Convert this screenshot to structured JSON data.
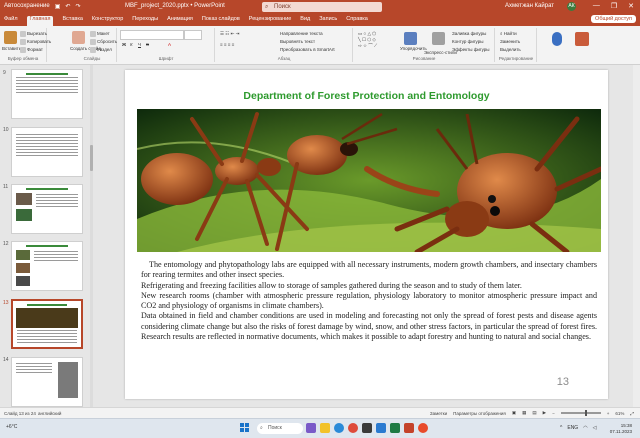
{
  "titlebar": {
    "autosave_label": "Автосохранение",
    "doc_title": "MBF_project_2020.pptx • PowerPoint",
    "search_placeholder": "Поиск",
    "user_name": "Ахметжан Кайрат",
    "avatar_initials": "АК",
    "min_glyph": "—",
    "max_glyph": "❐",
    "close_glyph": "✕"
  },
  "menu": {
    "tabs": [
      "Файл",
      "Главная",
      "Вставка",
      "Конструктор",
      "Переходы",
      "Анимация",
      "Показ слайдов",
      "Рецензирование",
      "Вид",
      "Запись",
      "Справка"
    ],
    "active_tab": "Главная",
    "share_label": "Общий доступ"
  },
  "ribbon": {
    "groups": [
      {
        "label": "Буфер обмена",
        "buttons": [
          "Вставить",
          "Вырезать",
          "Копировать",
          "Формат"
        ]
      },
      {
        "label": "Слайды",
        "buttons": [
          "Создать слайд",
          "Макет",
          "Сбросить",
          "Раздел"
        ]
      },
      {
        "label": "Шрифт",
        "buttons": [
          "Ж",
          "К",
          "Ч",
          "S"
        ]
      },
      {
        "label": "Абзац",
        "buttons": [
          "Направление текста",
          "Выровнять текст",
          "Преобразовать в SmartArt"
        ]
      },
      {
        "label": "Рисование",
        "buttons": [
          "Упорядочить",
          "Экспресс-стили",
          "Заливка фигуры",
          "Контур фигуры",
          "Эффекты фигуры"
        ]
      },
      {
        "label": "Редактирование",
        "buttons": [
          "Найти",
          "Заменить",
          "Выделить"
        ]
      }
    ]
  },
  "thumbnails": {
    "numbers": [
      "9",
      "10",
      "11",
      "12",
      "13",
      "14"
    ],
    "active": "13"
  },
  "slide": {
    "title": "Department of Forest Protection and Entomology",
    "paragraphs": [
      "The entomology and phytopathology labs are equipped with all necessary instruments, modern growth chambers, and insectary chambers for rearing termites and other insect species.",
      "Refrigerating and freezing facilities allow to storage of samples gathered during the season and to study of them later.",
      "New research rooms (chamber with atmospheric pressure regulation, physiology laboratory to monitor atmospheric pressure impact and CO2 and physiology of organisms in climate chambers).",
      "Data obtained in field and chamber conditions are used in modeling and forecasting not only the spread of forest pests and disease agents considering climate change but also the risks of forest damage by wind, snow, and other stress factors, in particular the spread of forest fires. Research results are reflected in normative documents, which makes it possible to adapt forestry and hunting to natural and social changes."
    ],
    "page_number": "13"
  },
  "statusbar": {
    "slide_info": "Слайд 13 из 24",
    "language": "английский",
    "notes_label": "Заметки",
    "display_label": "Параметры отображения",
    "zoom": "61%"
  },
  "taskbar": {
    "search_label": "Поиск",
    "weather": "+6°C",
    "tray_lang": "ENG",
    "time": "15:38",
    "date": "07.11.2023"
  },
  "colors": {
    "accent": "#b7472a",
    "title_green": "#2e9a2e"
  }
}
